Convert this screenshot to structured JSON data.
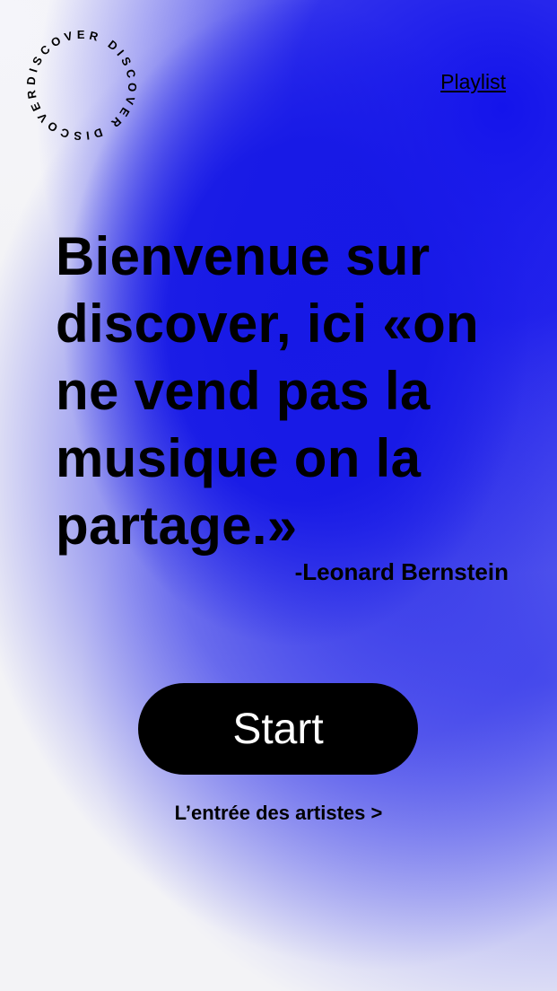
{
  "badge": {
    "text": "DISCOVER DISCOVER DISCOVER "
  },
  "nav": {
    "playlist_label": "Playlist"
  },
  "hero": {
    "quote": "Bienvenue sur discover, ici «on ne vend pas la musique on la partage.»",
    "author": "-Leonard Bernstein"
  },
  "actions": {
    "start_label": "Start",
    "artists_label": "L’entrée des artistes >"
  },
  "colors": {
    "accent_blue": "#1719e6",
    "background": "#f3f3f6",
    "button": "#000000",
    "button_text": "#ffffff"
  }
}
